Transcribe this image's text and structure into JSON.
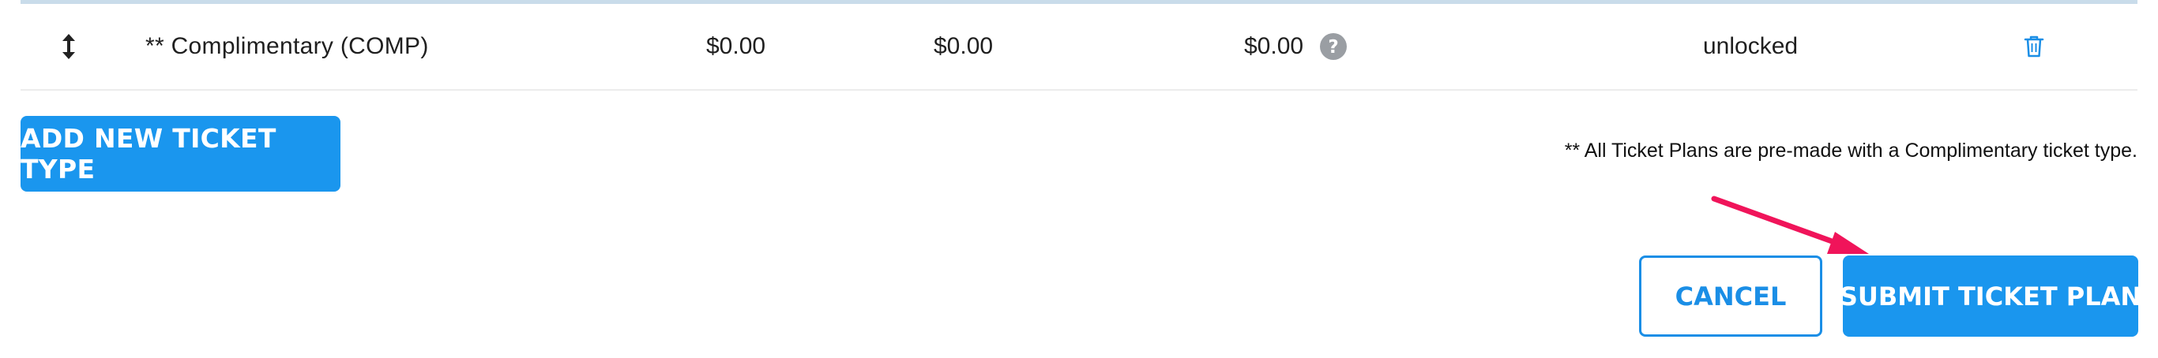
{
  "ticket_row": {
    "name": "** Complimentary (COMP)",
    "price": "$0.00",
    "fee": "$0.00",
    "total": "$0.00",
    "status": "unlocked"
  },
  "actions": {
    "add_label": "ADD NEW TICKET TYPE",
    "footnote": "** All Ticket Plans are pre-made with a Complimentary ticket type.",
    "cancel_label": "CANCEL",
    "submit_label": "SUBMIT TICKET PLAN"
  },
  "icons": {
    "drag": "up-down-arrow-icon",
    "help": "question-circle-icon",
    "delete": "trash-icon",
    "annotation": "red-arrow"
  },
  "colors": {
    "primary": "#1a96ee",
    "annotation_arrow": "#f0145a",
    "help_icon": "#9a9ea3"
  }
}
